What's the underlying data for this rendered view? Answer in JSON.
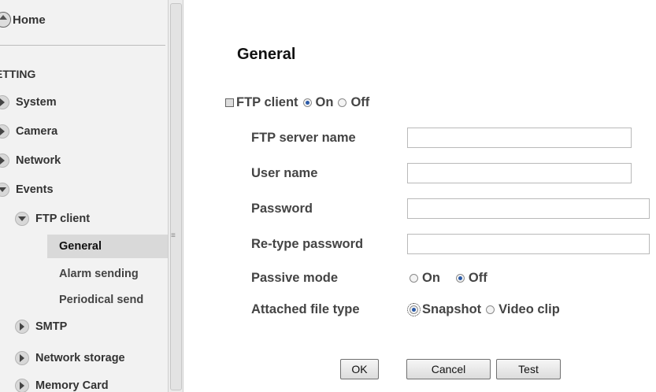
{
  "sidebar": {
    "home_label": "Home",
    "section_title": "ETTING",
    "items": [
      {
        "label": "System",
        "arrow": "right"
      },
      {
        "label": "Camera",
        "arrow": "right"
      },
      {
        "label": "Network",
        "arrow": "right"
      },
      {
        "label": "Events",
        "arrow": "down"
      }
    ],
    "ftp_client_label": "FTP client",
    "ftp_subitems": [
      "General",
      "Alarm sending",
      "Periodical send"
    ],
    "lower_items": [
      "SMTP",
      "Network storage",
      "Memory Card"
    ]
  },
  "main": {
    "title": "General",
    "ftp_client": {
      "label": "FTP client",
      "on_label": "On",
      "off_label": "Off",
      "selected": "On"
    },
    "fields": {
      "server_name": {
        "label": "FTP server name",
        "value": ""
      },
      "user_name": {
        "label": "User name",
        "value": ""
      },
      "password": {
        "label": "Password",
        "value": ""
      },
      "retype_password": {
        "label": "Re-type password",
        "value": ""
      }
    },
    "passive_mode": {
      "label": "Passive mode",
      "on_label": "On",
      "off_label": "Off",
      "selected": "Off"
    },
    "attached_file_type": {
      "label": "Attached file type",
      "snapshot_label": "Snapshot",
      "video_label": "Video clip",
      "selected": "Snapshot"
    },
    "buttons": {
      "ok": "OK",
      "cancel": "Cancel",
      "test": "Test"
    }
  }
}
